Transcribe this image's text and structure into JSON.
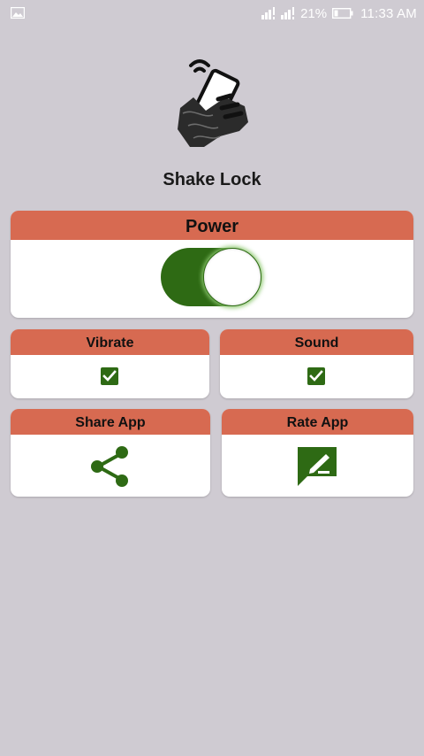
{
  "status_bar": {
    "signal_1": "ııl!",
    "signal_2": "ııl!",
    "battery_percent": "21%",
    "time": "11:33 AM"
  },
  "app": {
    "title": "Shake Lock",
    "logo_icon": "hand-shaking-phone-icon"
  },
  "power": {
    "header": "Power",
    "enabled": true
  },
  "vibrate": {
    "header": "Vibrate",
    "checked": true
  },
  "sound": {
    "header": "Sound",
    "checked": true
  },
  "share": {
    "header": "Share App",
    "icon": "share-icon"
  },
  "rate": {
    "header": "Rate App",
    "icon": "rate-feedback-icon"
  },
  "colors": {
    "background": "#cfcbd2",
    "header": "#d76a51",
    "accent_green": "#2e6a14",
    "card": "#ffffff"
  }
}
